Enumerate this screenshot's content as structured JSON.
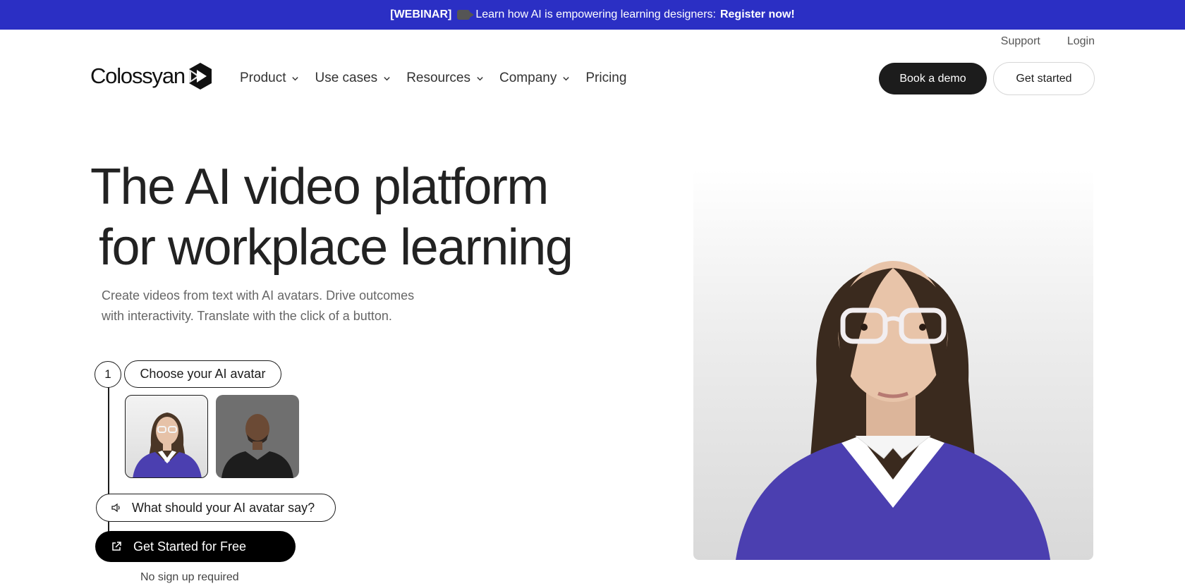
{
  "banner": {
    "prefix": "[WEBINAR]",
    "icon": "movie-camera-icon",
    "text": " Learn how AI is empowering learning designers: ",
    "cta": "Register now!",
    "bg_color": "#2b2fc4"
  },
  "utility_nav": {
    "support": "Support",
    "login": "Login"
  },
  "logo": {
    "text": "Colossyan",
    "icon": "play-hexagon-logo"
  },
  "nav": {
    "items": [
      {
        "label": "Product",
        "has_dropdown": true
      },
      {
        "label": "Use cases",
        "has_dropdown": true
      },
      {
        "label": "Resources",
        "has_dropdown": true
      },
      {
        "label": "Company",
        "has_dropdown": true
      },
      {
        "label": "Pricing",
        "has_dropdown": false
      }
    ]
  },
  "header_buttons": {
    "book_demo": "Book a demo",
    "get_started": "Get started"
  },
  "hero": {
    "title_line1": "The AI video platform",
    "title_line2": "for workplace learning",
    "subtitle_line1": "Create videos from text with AI avatars. Drive outcomes",
    "subtitle_line2": "with interactivity. Translate with the click of a button."
  },
  "builder": {
    "step_number": "1",
    "choose_avatar": "Choose your AI avatar",
    "avatars": [
      "avatar-woman-glasses",
      "avatar-man"
    ],
    "selected_avatar": "avatar-woman-glasses",
    "say_prompt": "What should your AI avatar say?",
    "say_icon": "speaker-icon",
    "cta": "Get Started for Free",
    "cta_icon": "external-link-icon",
    "note": "No sign up required"
  },
  "colors": {
    "dark": "#1c1c1c",
    "accent_purple": "#4b3fb0"
  }
}
